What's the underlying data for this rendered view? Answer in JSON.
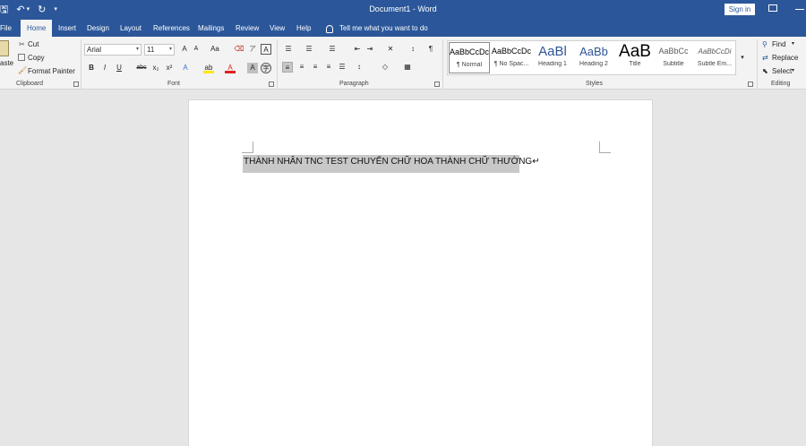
{
  "titlebar": {
    "title": "Document1  -  Word",
    "signin": "Sign in",
    "qat": {
      "save": "🖫",
      "undo": "↶",
      "undo_more": "▾",
      "redo": "↻",
      "customize": "▾"
    }
  },
  "tabs": [
    "File",
    "Home",
    "Insert",
    "Design",
    "Layout",
    "References",
    "Mailings",
    "Review",
    "View",
    "Help"
  ],
  "tell_me": "Tell me what you want to do",
  "ribbon": {
    "clipboard": {
      "label": "Clipboard",
      "paste": "aste",
      "cut": "Cut",
      "copy": "Copy",
      "format_painter": "Format Painter"
    },
    "font": {
      "label": "Font",
      "font_name": "Arial",
      "font_size": "11",
      "grow": "A",
      "shrink": "A",
      "change_case": "Aa",
      "bold": "B",
      "italic": "I",
      "underline": "U",
      "strikethrough": "abc",
      "subscript": "x₂",
      "superscript": "x²",
      "text_effects": "A",
      "font_color": "A",
      "char_shading": "A",
      "enclose": "A"
    },
    "paragraph": {
      "label": "Paragraph"
    },
    "styles": {
      "label": "Styles",
      "items": [
        {
          "preview": "AaBbCcDc",
          "name": "¶ Normal"
        },
        {
          "preview": "AaBbCcDc",
          "name": "¶ No Spac..."
        },
        {
          "preview": "AaBl",
          "name": "Heading 1"
        },
        {
          "preview": "AaBb",
          "name": "Heading 2"
        },
        {
          "preview": "AaB",
          "name": "Title"
        },
        {
          "preview": "AaBbCc",
          "name": "Subtitle"
        },
        {
          "preview": "AaBbCcDi",
          "name": "Subtle Em..."
        }
      ]
    },
    "editing": {
      "label": "Editing",
      "find": "Find",
      "replace": "Replace",
      "select": "Select"
    }
  },
  "document": {
    "text": "THÀNH NHÂN TNC TEST CHUYỂN CHỮ HOA THÀNH CHỮ THƯỜNG↵"
  },
  "colors": {
    "accent": "#2b579a",
    "ribbon": "#f3f3f3",
    "canvas": "#e6e6e6",
    "selection": "#c8c8c8",
    "font_color_red": "#e02020",
    "highlight_yellow": "#ffe600"
  }
}
